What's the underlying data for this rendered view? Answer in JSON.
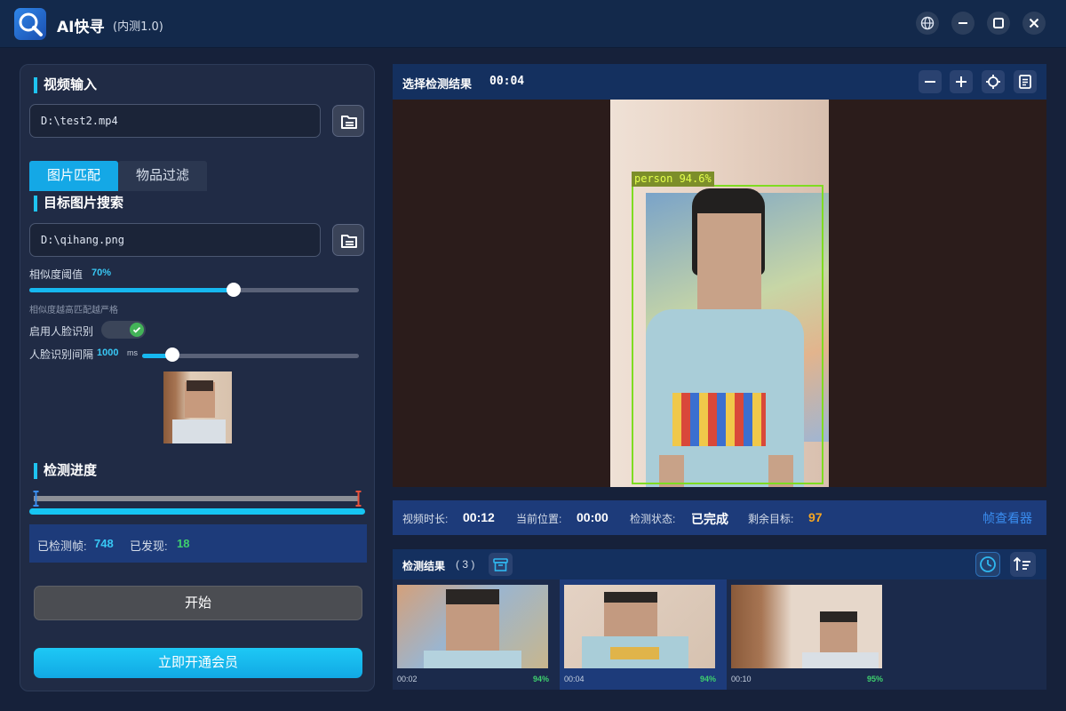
{
  "window": {
    "title": "AI快寻",
    "version": "(内测1.0)",
    "buttons": [
      "globe-icon",
      "minimize-icon",
      "maximize-icon",
      "close-icon"
    ]
  },
  "left": {
    "video_input": {
      "title": "视频输入",
      "path": "D:\\test2.mp4"
    },
    "tabs": [
      {
        "label": "图片匹配",
        "active": true
      },
      {
        "label": "物品过滤",
        "active": false
      }
    ],
    "target_search": {
      "title": "目标图片搜索",
      "path": "D:\\qihang.png"
    },
    "similarity": {
      "label": "相似度阈值",
      "value_text": "70%",
      "value": 0.62,
      "hint": "相似度越高匹配越严格"
    },
    "face_recognition": {
      "label": "启用人脸识别",
      "enabled": true
    },
    "face_interval": {
      "label": "人脸识别间隔",
      "value_text": "1000",
      "unit": "ms",
      "value": 0.14
    },
    "progress": {
      "title": "检测进度",
      "fraction": 1.0,
      "frames_label": "已检测帧:",
      "frames_value": "748",
      "found_label": "已发现:",
      "found_value": "18"
    },
    "start_button": "开始",
    "vip_button": "立即开通会员"
  },
  "viewer": {
    "title": "选择检测结果",
    "time": "00:04",
    "tools": [
      "zoom-out-icon",
      "zoom-in-icon",
      "locate-icon",
      "document-icon"
    ],
    "detection_label": "person 94.6%"
  },
  "info_bar": {
    "duration_label": "视频时长:",
    "duration": "00:12",
    "position_label": "当前位置:",
    "position": "00:00",
    "status_label": "检测状态:",
    "status": "已完成",
    "remaining_label": "剩余目标:",
    "remaining": "97",
    "frame_viewer_link": "帧查看器"
  },
  "results": {
    "title": "检测结果",
    "count": "( 3 )",
    "items": [
      {
        "time": "00:02",
        "score": "94%"
      },
      {
        "time": "00:04",
        "score": "94%"
      },
      {
        "time": "00:10",
        "score": "95%"
      }
    ]
  },
  "colors": {
    "accent": "#16b8f0",
    "panel": "#202b45",
    "header": "#14305f",
    "detection": "#7fdc21",
    "success": "#3ed06e",
    "warning": "#f5a623"
  }
}
